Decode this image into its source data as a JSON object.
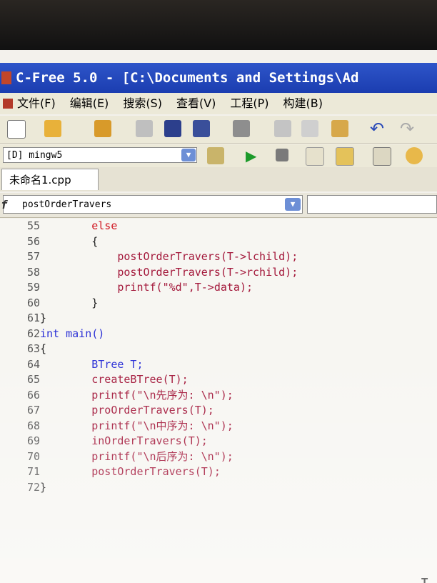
{
  "window": {
    "title": "C-Free 5.0 - [C:\\Documents and Settings\\Ad"
  },
  "menu": {
    "items": [
      "文件(F)",
      "编辑(E)",
      "搜索(S)",
      "查看(V)",
      "工程(P)",
      "构建(B)"
    ]
  },
  "toolbar": {
    "icons": [
      "new-file-icon",
      "open-folder-icon",
      "save-icon",
      "save-all-icon",
      "print-icon",
      "cut-icon",
      "copy-icon",
      "paste-icon",
      "undo-icon",
      "redo-icon"
    ]
  },
  "compiler": {
    "selected": "[D] mingw5"
  },
  "editor": {
    "tab_label": "未命名1.cpp",
    "function_selector": "postOrderTravers",
    "function_icon": "f",
    "lines": [
      {
        "n": "55",
        "t": "        else"
      },
      {
        "n": "56",
        "t": "        {"
      },
      {
        "n": "57",
        "t": "            postOrderTravers(T->lchild);"
      },
      {
        "n": "58",
        "t": "            postOrderTravers(T->rchild);"
      },
      {
        "n": "59",
        "t": "            printf(\"%d\",T->data);"
      },
      {
        "n": "60",
        "t": "        }"
      },
      {
        "n": "61",
        "t": "}"
      },
      {
        "n": "62",
        "t": "int main()"
      },
      {
        "n": "63",
        "t": "{"
      },
      {
        "n": "64",
        "t": "        BTree T;"
      },
      {
        "n": "65",
        "t": "        createBTree(T);"
      },
      {
        "n": "66",
        "t": "        printf(\"\\n先序为: \\n\");"
      },
      {
        "n": "67",
        "t": "        proOrderTravers(T);"
      },
      {
        "n": "68",
        "t": "        printf(\"\\n中序为: \\n\");"
      },
      {
        "n": "69",
        "t": "        inOrderTravers(T);"
      },
      {
        "n": "70",
        "t": "        printf(\"\\n后序为: \\n\");"
      },
      {
        "n": "71",
        "t": "        postOrderTravers(T);"
      },
      {
        "n": "72",
        "t": "}"
      }
    ]
  }
}
